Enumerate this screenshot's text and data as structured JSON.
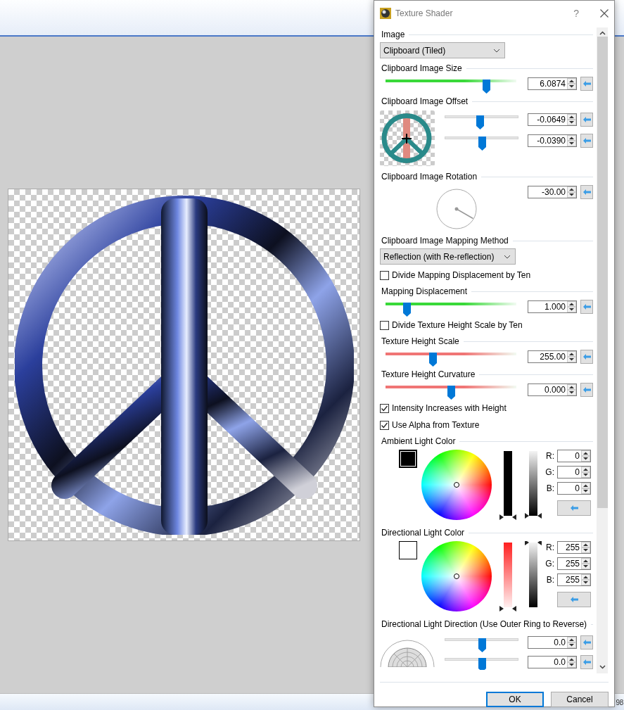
{
  "main_window": {
    "status_text": "98"
  },
  "dialog": {
    "title": "Texture Shader",
    "help": "?",
    "sections": [
      {
        "kind": "dropdown",
        "heading": "Image",
        "value": "Clipboard (Tiled)"
      },
      {
        "kind": "slider",
        "heading": "Clipboard Image Size",
        "color": "#39d939",
        "level": 0.77,
        "value": "6.0874"
      },
      {
        "kind": "offset",
        "heading": "Clipboard Image Offset",
        "sliders": [
          {
            "level": 0.48,
            "value": "-0.0649"
          },
          {
            "level": 0.5,
            "value": "-0.0390"
          }
        ]
      },
      {
        "kind": "rotation",
        "heading": "Clipboard Image Rotation",
        "value": "-30.00"
      },
      {
        "kind": "dropdown",
        "heading": "Clipboard Image Mapping Method",
        "value": "Reflection (with Re-reflection)"
      },
      {
        "kind": "checkbox",
        "label": "Divide Mapping Displacement by Ten",
        "checked": false
      },
      {
        "kind": "slider",
        "heading": "Mapping Displacement",
        "color": "#39d939",
        "level": 0.16,
        "value": "1.000"
      },
      {
        "kind": "checkbox",
        "label": "Divide Texture Height Scale by Ten",
        "checked": false
      },
      {
        "kind": "slider",
        "heading": "Texture Height Scale",
        "color": "#f07575",
        "level": 0.36,
        "value": "255.00"
      },
      {
        "kind": "slider",
        "heading": "Texture Height Curvature",
        "color": "#f07575",
        "level": 0.5,
        "value": "0.000"
      },
      {
        "kind": "checkbox",
        "label": "Intensity Increases with Height",
        "checked": true
      },
      {
        "kind": "checkbox",
        "label": "Use Alpha from Texture",
        "checked": true
      },
      {
        "kind": "color",
        "heading": "Ambient Light Color",
        "color": "#000000",
        "channels": [
          {
            "label": "R:",
            "value": "0"
          },
          {
            "label": "G:",
            "value": "0"
          },
          {
            "label": "B:",
            "value": "0"
          }
        ]
      },
      {
        "kind": "color",
        "heading": "Directional Light Color",
        "color": "#ffffff",
        "channels": [
          {
            "label": "R:",
            "value": "255"
          },
          {
            "label": "G:",
            "value": "255"
          },
          {
            "label": "B:",
            "value": "255"
          }
        ]
      },
      {
        "kind": "direction",
        "heading": "Directional Light Direction (Use Outer Ring to Reverse)",
        "sliders": [
          {
            "level": 0.5,
            "value": "0.0"
          },
          {
            "level": 0.5,
            "value": "0.0"
          }
        ]
      }
    ],
    "buttons": [
      {
        "label": "OK",
        "default": true
      },
      {
        "label": "Cancel",
        "default": false
      }
    ]
  }
}
